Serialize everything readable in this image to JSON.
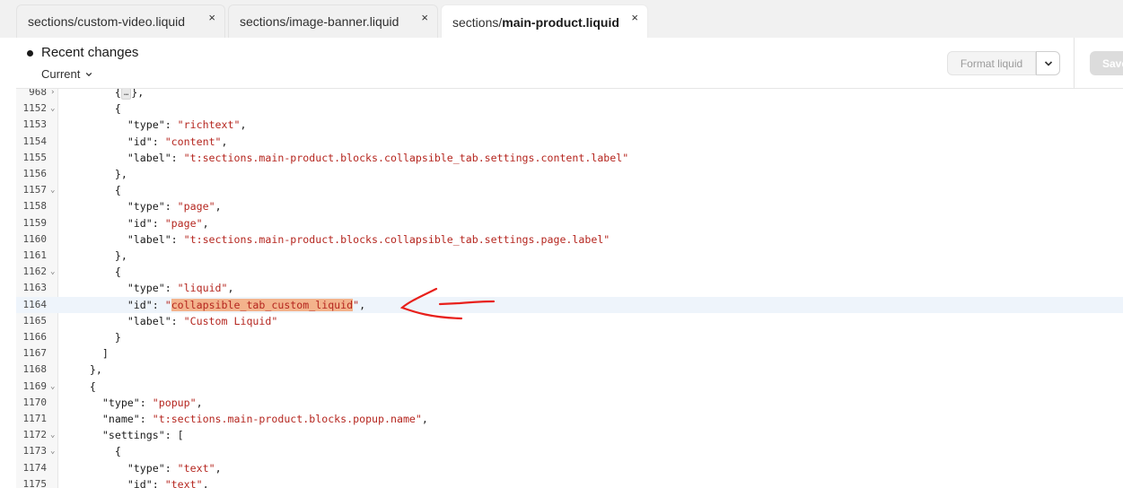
{
  "tabs": [
    {
      "label": "sections/custom-video.liquid",
      "close": "×"
    },
    {
      "label": "sections/image-banner.liquid",
      "close": "×"
    },
    {
      "label_prefix": "sections/",
      "label_strong": "main-product.liquid",
      "close": "×"
    }
  ],
  "header": {
    "title": "Recent changes",
    "version": "Current",
    "format_label": "Format liquid",
    "save_label": "Save"
  },
  "annotation": {
    "color": "#e8201b"
  },
  "code_lines": [
    {
      "n": "968",
      "fold": "›",
      "indent": "        ",
      "text": "{…},"
    },
    {
      "n": "1152",
      "fold": "⌄",
      "indent": "        ",
      "text": "{"
    },
    {
      "n": "1153",
      "fold": "",
      "indent": "          ",
      "key": "\"type\"",
      "val": "\"richtext\"",
      "tail": ","
    },
    {
      "n": "1154",
      "fold": "",
      "indent": "          ",
      "key": "\"id\"",
      "val": "\"content\"",
      "tail": ","
    },
    {
      "n": "1155",
      "fold": "",
      "indent": "          ",
      "key": "\"label\"",
      "val": "\"t:sections.main-product.blocks.collapsible_tab.settings.content.label\"",
      "tail": ""
    },
    {
      "n": "1156",
      "fold": "",
      "indent": "        ",
      "text": "},"
    },
    {
      "n": "1157",
      "fold": "⌄",
      "indent": "        ",
      "text": "{"
    },
    {
      "n": "1158",
      "fold": "",
      "indent": "          ",
      "key": "\"type\"",
      "val": "\"page\"",
      "tail": ","
    },
    {
      "n": "1159",
      "fold": "",
      "indent": "          ",
      "key": "\"id\"",
      "val": "\"page\"",
      "tail": ","
    },
    {
      "n": "1160",
      "fold": "",
      "indent": "          ",
      "key": "\"label\"",
      "val": "\"t:sections.main-product.blocks.collapsible_tab.settings.page.label\"",
      "tail": ""
    },
    {
      "n": "1161",
      "fold": "",
      "indent": "        ",
      "text": "},"
    },
    {
      "n": "1162",
      "fold": "⌄",
      "indent": "        ",
      "text": "{"
    },
    {
      "n": "1163",
      "fold": "",
      "indent": "          ",
      "key": "\"type\"",
      "val": "\"liquid\"",
      "tail": ","
    },
    {
      "n": "1164",
      "fold": "",
      "indent": "          ",
      "key": "\"id\"",
      "val_sel": "collapsible_tab_custom_liquid",
      "tail": ",",
      "highlight": true
    },
    {
      "n": "1165",
      "fold": "",
      "indent": "          ",
      "key": "\"label\"",
      "val": "\"Custom Liquid\"",
      "tail": ""
    },
    {
      "n": "1166",
      "fold": "",
      "indent": "        ",
      "text": "}"
    },
    {
      "n": "1167",
      "fold": "",
      "indent": "      ",
      "text": "]"
    },
    {
      "n": "1168",
      "fold": "",
      "indent": "    ",
      "text": "},"
    },
    {
      "n": "1169",
      "fold": "⌄",
      "indent": "    ",
      "text": "{"
    },
    {
      "n": "1170",
      "fold": "",
      "indent": "      ",
      "key": "\"type\"",
      "val": "\"popup\"",
      "tail": ","
    },
    {
      "n": "1171",
      "fold": "",
      "indent": "      ",
      "key": "\"name\"",
      "val": "\"t:sections.main-product.blocks.popup.name\"",
      "tail": ","
    },
    {
      "n": "1172",
      "fold": "⌄",
      "indent": "      ",
      "key": "\"settings\"",
      "raw_after": " [",
      "tail": ""
    },
    {
      "n": "1173",
      "fold": "⌄",
      "indent": "        ",
      "text": "{"
    },
    {
      "n": "1174",
      "fold": "",
      "indent": "          ",
      "key": "\"type\"",
      "val": "\"text\"",
      "tail": ","
    },
    {
      "n": "1175",
      "fold": "",
      "indent": "          ",
      "key": "\"id\"",
      "val": "\"text\"",
      "tail": ","
    }
  ]
}
